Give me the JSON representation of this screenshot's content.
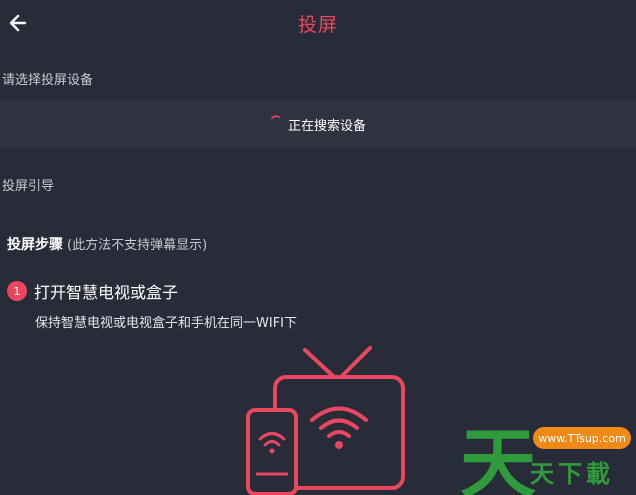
{
  "header": {
    "back_icon": "arrow-left-icon",
    "title": "投屏"
  },
  "device_section": {
    "label": "请选择投屏设备",
    "status_text": "正在搜索设备"
  },
  "guide_section": {
    "label": "投屏引导",
    "steps_title": "投屏步骤",
    "steps_note": "(此方法不支持弹幕显示)",
    "step1": {
      "number": "1",
      "title": "打开智慧电视或盒子",
      "description": "保持智慧电视或电视盒子和手机在同一WIFI下"
    }
  },
  "watermark": {
    "url": "www.TTsup.com",
    "big_char": "天",
    "chars": "天下載"
  },
  "colors": {
    "background": "#282b38",
    "row_background": "#30333f",
    "accent": "#e8475f",
    "watermark_green": "#2f9b3c",
    "watermark_orange": "#f08a16"
  }
}
